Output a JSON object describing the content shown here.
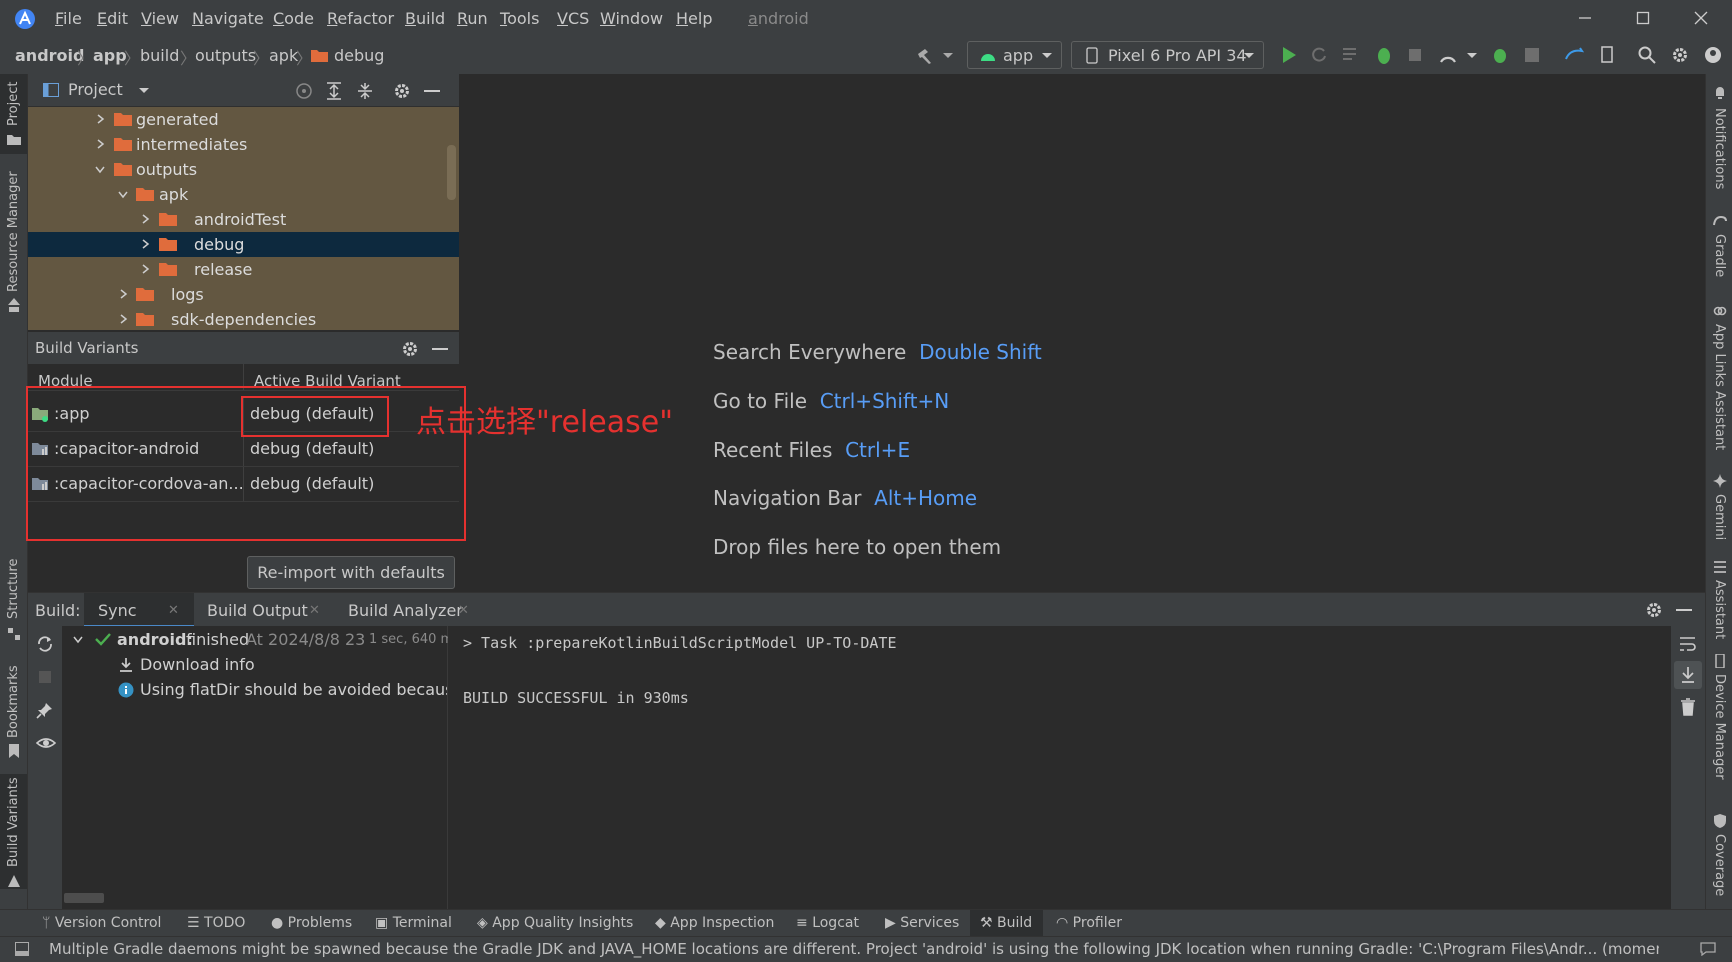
{
  "menubar": {
    "items": [
      "File",
      "Edit",
      "View",
      "Navigate",
      "Code",
      "Refactor",
      "Build",
      "Run",
      "Tools",
      "VCS",
      "Window",
      "Help"
    ],
    "project_name": "android"
  },
  "navbar": {
    "breadcrumbs": [
      "android",
      "app",
      "build",
      "outputs",
      "apk",
      "debug"
    ],
    "run_config": "app",
    "device": "Pixel 6 Pro API 34"
  },
  "left_strip": {
    "tabs": [
      "Project",
      "Resource Manager",
      "Structure",
      "Bookmarks",
      "Build Variants"
    ]
  },
  "right_strip": {
    "tabs": [
      "Notifications",
      "Gradle",
      "App Links Assistant",
      "Gemini",
      "Assistant",
      "Device Manager",
      "Coverage"
    ]
  },
  "project_panel": {
    "title": "Project",
    "tree": [
      {
        "label": "generated",
        "depth": 1,
        "expanded": false,
        "selected": false
      },
      {
        "label": "intermediates",
        "depth": 1,
        "expanded": false,
        "selected": false
      },
      {
        "label": "outputs",
        "depth": 1,
        "expanded": true,
        "selected": false
      },
      {
        "label": "apk",
        "depth": 2,
        "expanded": true,
        "selected": false
      },
      {
        "label": "androidTest",
        "depth": 3,
        "expanded": false,
        "selected": false
      },
      {
        "label": "debug",
        "depth": 3,
        "expanded": false,
        "selected": true
      },
      {
        "label": "release",
        "depth": 3,
        "expanded": false,
        "selected": false
      },
      {
        "label": "logs",
        "depth": 2,
        "expanded": false,
        "selected": false
      },
      {
        "label": "sdk-dependencies",
        "depth": 2,
        "expanded": false,
        "selected": false
      }
    ]
  },
  "build_variants": {
    "title": "Build Variants",
    "col_module": "Module",
    "col_variant": "Active Build Variant",
    "rows": [
      {
        "module": ":app",
        "variant": "debug (default)"
      },
      {
        "module": ":capacitor-android",
        "variant": "debug (default)"
      },
      {
        "module": ":capacitor-cordova-an...",
        "variant": "debug (default)"
      }
    ],
    "reimport_label": "Re-import with defaults"
  },
  "annotation": "点击选择\"release\"",
  "editor_hints": [
    {
      "text": "Search Everywhere",
      "key": "Double Shift"
    },
    {
      "text": "Go to File",
      "key": "Ctrl+Shift+N"
    },
    {
      "text": "Recent Files",
      "key": "Ctrl+E"
    },
    {
      "text": "Navigation Bar",
      "key": "Alt+Home"
    },
    {
      "text": "Drop files here to open them",
      "key": ""
    }
  ],
  "build_panel": {
    "label": "Build:",
    "tabs": [
      "Sync",
      "Build Output",
      "Build Analyzer"
    ],
    "tree": {
      "root_name": "android:",
      "root_status": "finished",
      "root_time": "At 2024/8/8 23",
      "root_duration": "1 sec, 640 ms",
      "children": [
        "Download info",
        "Using flatDir should be avoided because it"
      ]
    },
    "console": [
      "> Task :prepareKotlinBuildScriptModel UP-TO-DATE",
      "",
      "BUILD SUCCESSFUL in 930ms"
    ]
  },
  "toolwindows": [
    "Version Control",
    "TODO",
    "Problems",
    "Terminal",
    "App Quality Insights",
    "App Inspection",
    "Logcat",
    "Services",
    "Build",
    "Profiler"
  ],
  "status_message": "Multiple Gradle daemons might be spawned because the Gradle JDK and JAVA_HOME locations are different. Project 'android' is using the following JDK location when running Gradle: 'C:\\Program Files\\Andr... (moments ag",
  "colors": {
    "accent": "#589df6",
    "annotation": "#e5312f",
    "folder": "#e06c3c",
    "run_green": "#4caf50"
  }
}
